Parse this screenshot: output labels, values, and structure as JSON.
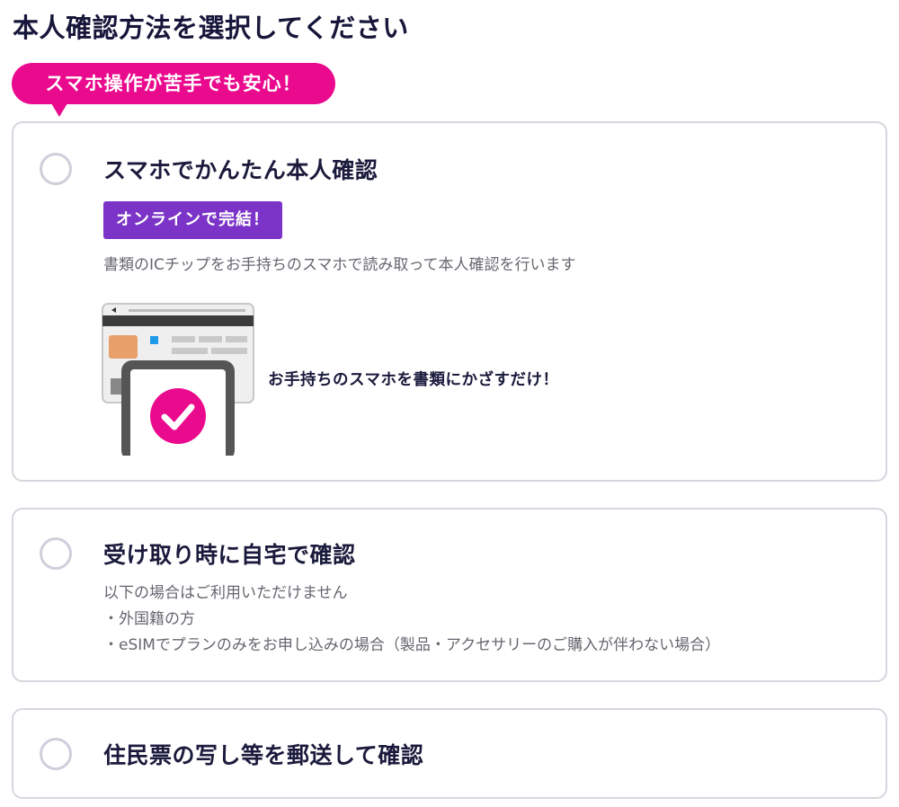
{
  "page": {
    "title": "本人確認方法を選択してください"
  },
  "promo_badge": "スマホ操作が苦手でも安心！",
  "options": [
    {
      "title": "スマホでかんたん本人確認",
      "tag": "オンラインで完結！",
      "description": "書類のICチップをお手持ちのスマホで読み取って本人確認を行います",
      "illustration_caption": "お手持ちのスマホを書類にかざすだけ！",
      "selected": false
    },
    {
      "title": "受け取り時に自宅で確認",
      "notes": [
        "以下の場合はご利用いただけません",
        "・外国籍の方",
        "・eSIMでプランのみをお申し込みの場合（製品・アクセサリーのご購入が伴わない場合）"
      ],
      "selected": false
    },
    {
      "title": "住民票の写し等を郵送して確認",
      "selected": false
    }
  ],
  "colors": {
    "brand_pink": "#ea0a8e",
    "tag_purple": "#7b34c7",
    "border": "#d6d6de",
    "radio": "#cfcfdc",
    "title_text": "#16163a"
  },
  "icons": {
    "radio": "radio-unselected-icon",
    "check": "checkmark-circle-icon"
  }
}
